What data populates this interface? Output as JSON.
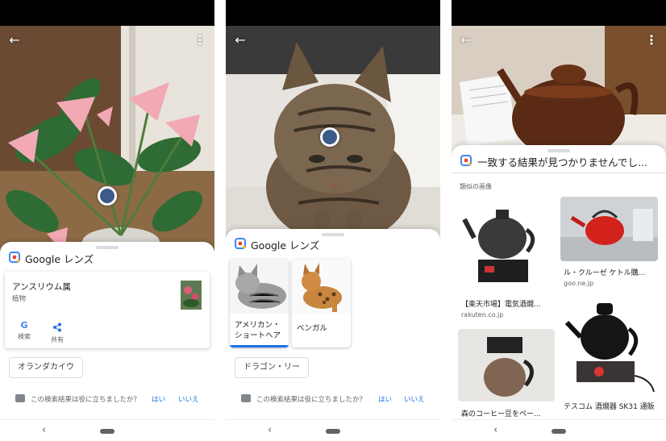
{
  "panel1": {
    "sheet_title": "Google レンズ",
    "result": {
      "name": "アンスリウム属",
      "category": "植物"
    },
    "actions": [
      {
        "icon": "google-g-icon",
        "label": "検索"
      },
      {
        "icon": "share-icon",
        "label": "共有"
      }
    ],
    "chip": "オランダカイウ",
    "feedback": {
      "question": "この検索結果は役に立ちましたか？",
      "yes": "はい",
      "no": "いいえ"
    }
  },
  "panel2": {
    "sheet_title": "Google レンズ",
    "results": [
      {
        "label": "アメリカン・ショートヘア",
        "selected": true
      },
      {
        "label": "ベンガル",
        "selected": false
      }
    ],
    "chip": "ドラゴン・リー",
    "feedback": {
      "question": "この検索結果は役に立ちましたか？",
      "yes": "はい",
      "no": "いいえ"
    }
  },
  "panel3": {
    "sheet_title": "一致する結果が見つかりませんでし...",
    "similar_heading": "類似の画像",
    "items": [
      {
        "caption": "【楽天市場】電気酒燗...",
        "source": "rakuten.co.jp"
      },
      {
        "caption": "ル・クルーゼ ケトル購...",
        "source": "goo.ne.jp"
      },
      {
        "caption": "森のコーヒー豆をペー...",
        "source": ""
      },
      {
        "caption": "テスコム 酒燗器 SK31 通販",
        "source": ""
      }
    ]
  },
  "colors": {
    "accent": "#1a73e8",
    "focus_dot": "#3c5a8a",
    "status_bar": "#000000"
  }
}
